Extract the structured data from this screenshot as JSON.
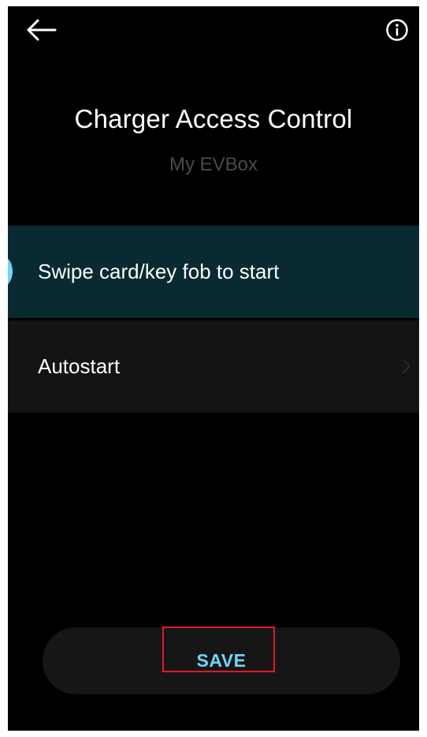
{
  "header": {
    "back_icon": "arrow-left-icon",
    "info_icon": "info-circle-icon"
  },
  "page": {
    "title": "Charger Access Control",
    "subtitle": "My EVBox"
  },
  "options": [
    {
      "label": "Swipe card/key fob to start",
      "selected": true
    },
    {
      "label": "Autostart",
      "selected": false
    }
  ],
  "footer": {
    "save_label": "SAVE"
  },
  "colors": {
    "background": "#000000",
    "accent": "#6fd6f5",
    "selected_row": "#092a30",
    "row": "#141414",
    "highlight": "#e01b24"
  }
}
